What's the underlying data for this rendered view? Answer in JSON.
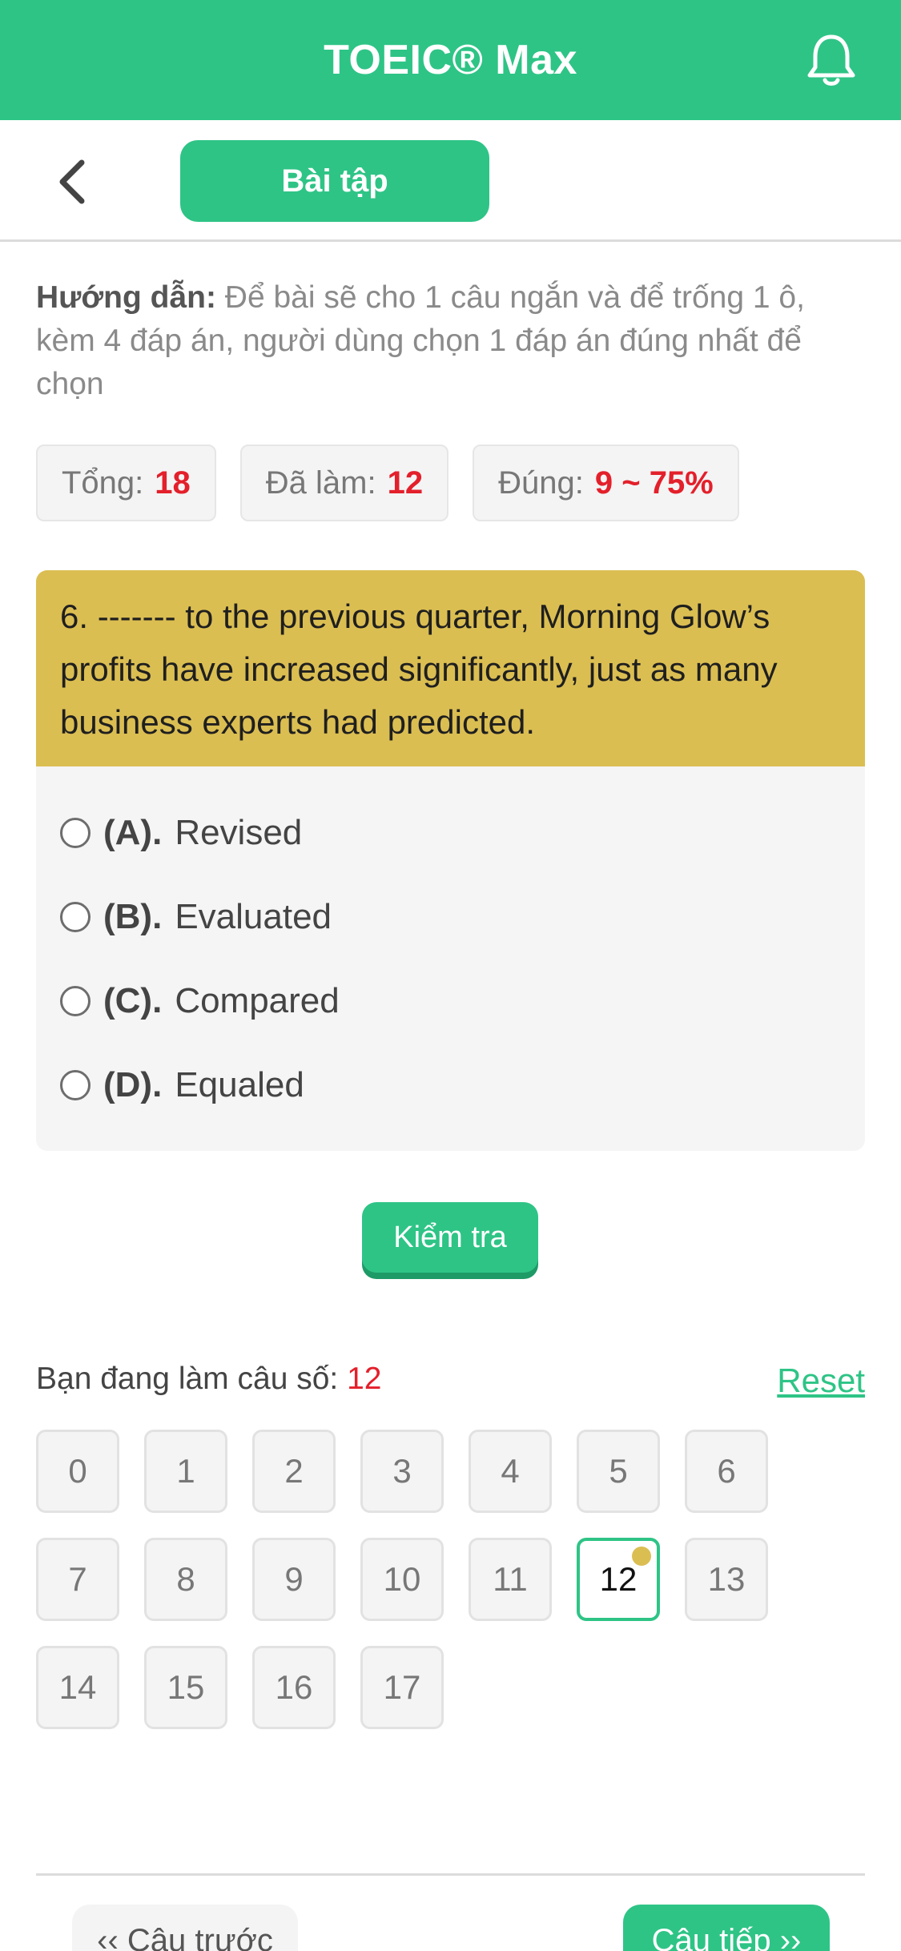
{
  "appbar": {
    "title": "TOEIC® Max",
    "icon": "bell-icon"
  },
  "subbar": {
    "back_icon": "chevron-left-icon",
    "tab_label": "Bài tập"
  },
  "instruction": {
    "label": "Hướng dẫn:",
    "text": " Để bài sẽ cho 1 câu ngắn và để trống 1 ô, kèm 4 đáp án, người dùng chọn 1 đáp án đúng nhất để chọn"
  },
  "stats": {
    "total_label": "Tổng:",
    "total_value": "18",
    "done_label": "Đã làm:",
    "done_value": "12",
    "correct_label": "Đúng:",
    "correct_value": "9 ~ 75%"
  },
  "question": {
    "text": "6. ------- to the previous quarter, Morning Glow’s profits have increased significantly, just as many business experts had predicted.",
    "options": [
      {
        "key": "(A).",
        "text": "Revised"
      },
      {
        "key": "(B).",
        "text": "Evaluated"
      },
      {
        "key": "(C).",
        "text": "Compared"
      },
      {
        "key": "(D).",
        "text": "Equaled"
      }
    ]
  },
  "check_button": "Kiểm tra",
  "progress": {
    "current_label": "Bạn đang làm câu số: ",
    "current_value": "12",
    "reset_label": "Reset",
    "cells": [
      "0",
      "1",
      "2",
      "3",
      "4",
      "5",
      "6",
      "7",
      "8",
      "9",
      "10",
      "11",
      "12",
      "13",
      "14",
      "15",
      "16",
      "17"
    ],
    "active_index": 12
  },
  "nav": {
    "prev_label": "‹‹ Câu trước",
    "next_label": "Câu tiếp ››"
  },
  "colors": {
    "primary": "#2ec486",
    "question_bg": "#dbbe52",
    "highlight": "#e3202b"
  }
}
